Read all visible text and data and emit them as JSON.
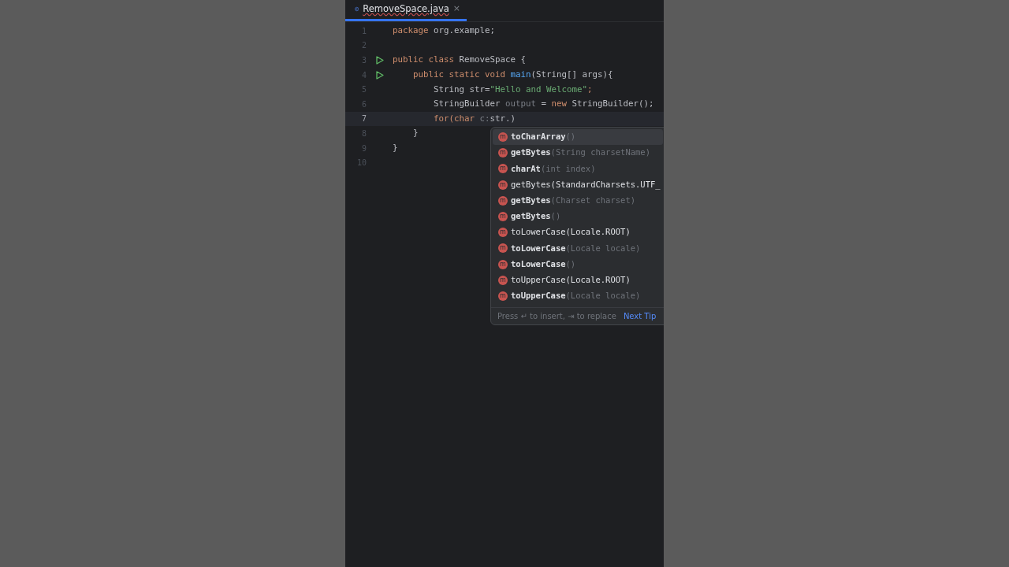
{
  "tab": {
    "title": "RemoveSpace.java",
    "selected": true,
    "close": "×"
  },
  "lines": [
    {
      "number": "1",
      "current": false,
      "run": false,
      "tokens": [
        {
          "text": "package ",
          "kind": "keyword"
        },
        {
          "text": "org.example;",
          "kind": "plain"
        }
      ]
    },
    {
      "number": "2",
      "current": false,
      "run": false
    },
    {
      "number": "3",
      "current": false,
      "run": true,
      "tokens": [
        {
          "text": "public class ",
          "kind": "keyword"
        },
        {
          "text": "RemoveSpace {",
          "kind": "plain"
        }
      ]
    },
    {
      "number": "4",
      "current": false,
      "run": true,
      "tokens": [
        {
          "text": "    public static void ",
          "kind": "keyword"
        },
        {
          "text": "main",
          "kind": "method"
        },
        {
          "text": "(String[] args){",
          "kind": "plain"
        }
      ]
    },
    {
      "number": "5",
      "current": false,
      "run": false,
      "tokens": [
        {
          "text": "        String str=",
          "kind": "plain"
        },
        {
          "text": "\"Hello and Welcome\"",
          "kind": "string"
        },
        {
          "text": ";",
          "kind": "keyword"
        }
      ]
    },
    {
      "number": "6",
      "current": false,
      "run": false,
      "tokens": [
        {
          "text": "        StringBuilder ",
          "kind": "plain"
        },
        {
          "text": "output",
          "kind": "unused"
        },
        {
          "text": " = ",
          "kind": "plain"
        },
        {
          "text": "new ",
          "kind": "keyword"
        },
        {
          "text": "StringBuilder();",
          "kind": "plain"
        }
      ]
    },
    {
      "number": "7",
      "current": true,
      "run": false,
      "tokens": [
        {
          "text": "        for(char ",
          "kind": "keyword"
        },
        {
          "text": "c:",
          "kind": "unused"
        },
        {
          "text": "str.)",
          "kind": "plain"
        }
      ]
    },
    {
      "number": "8",
      "current": false,
      "run": false,
      "tokens": [
        {
          "text": "    }",
          "kind": "plain"
        }
      ]
    },
    {
      "number": "9",
      "current": false,
      "run": false,
      "tokens": [
        {
          "text": "}",
          "kind": "plain"
        }
      ]
    },
    {
      "number": "10",
      "current": false,
      "run": false
    }
  ],
  "completion": {
    "items": [
      {
        "kind": "method",
        "icon": "m",
        "name": "toCharArray",
        "params": "()",
        "selected": true
      },
      {
        "kind": "method",
        "icon": "m",
        "name": "getBytes",
        "params": "(String charsetName)",
        "selected": false
      },
      {
        "kind": "method",
        "icon": "m",
        "name": "charAt",
        "params": "(int index)",
        "selected": false
      },
      {
        "kind": "template",
        "icon": "m",
        "name": "getBytes(StandardCharsets.UTF_",
        "selected": false
      },
      {
        "kind": "method",
        "icon": "m",
        "name": "getBytes",
        "params": "(Charset charset)",
        "selected": false
      },
      {
        "kind": "method",
        "icon": "m",
        "name": "getBytes",
        "params": "()",
        "selected": false
      },
      {
        "kind": "template",
        "icon": "m",
        "name": "toLowerCase(Locale.ROOT)",
        "selected": false
      },
      {
        "kind": "method",
        "icon": "m",
        "name": "toLowerCase",
        "params": "(Locale locale)",
        "selected": false
      },
      {
        "kind": "method",
        "icon": "m",
        "name": "toLowerCase",
        "params": "()",
        "selected": false
      },
      {
        "kind": "template",
        "icon": "m",
        "name": "toUpperCase(Locale.ROOT)",
        "selected": false
      },
      {
        "kind": "method",
        "icon": "m",
        "name": "toUpperCase",
        "params": "(Locale locale)",
        "selected": false
      }
    ],
    "hint": "Press ↵ to insert, ⇥ to replace",
    "next_tip": "Next Tip"
  }
}
